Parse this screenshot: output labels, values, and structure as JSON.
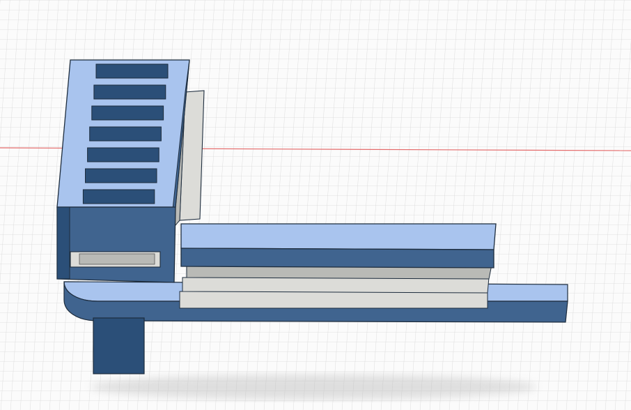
{
  "viewport": {
    "background": "#fbfbfb",
    "grid_color": "#d6d6d6",
    "axis_color": "#e46a6a",
    "grid_visible": true
  },
  "model": {
    "shade_light": "#a9c4ee",
    "shade_mid": "#40648f",
    "shade_dark": "#2b4f78",
    "gray_light": "#dcdcd8",
    "gray_mid": "#b9bab6",
    "outline": "#1d2c3d"
  }
}
